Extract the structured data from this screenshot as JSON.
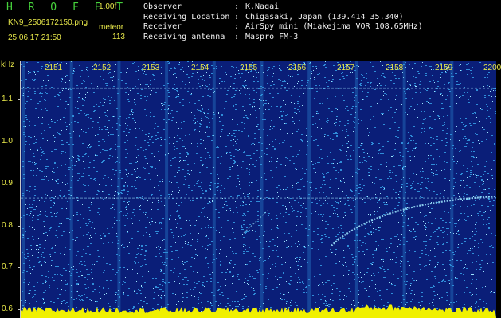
{
  "header": {
    "title": "H R O F F T",
    "version": "1.00f",
    "filename": "KN9_2506172150.png",
    "meteor_label": "meteor",
    "datetime": "25.06.17 21:50",
    "count": "113",
    "info": [
      {
        "key": "Observer",
        "value": "K.Nagai"
      },
      {
        "key": "Receiving Location",
        "value": "Chigasaki, Japan (139.414 35.340)"
      },
      {
        "key": "Receiver",
        "value": "AirSpy mini (Miakejima VOR 108.65MHz)"
      },
      {
        "key": "Receiving antenna",
        "value": "Maspro FM-3"
      }
    ],
    "separator": ":"
  },
  "colors": {
    "background": "#000000",
    "label": "#e8e84a",
    "title": "#46d23c",
    "text": "#f2f2f2",
    "spectrogram_base": "#0a1e78",
    "noise": "#2f8cd8",
    "signal": "#9ee6ff",
    "baseline": "#f0f000"
  },
  "spectrogram": {
    "y_unit": "kHz",
    "y_ticks": [
      "1.1",
      "1.0",
      "0.9",
      "0.8",
      "0.7",
      "0.6"
    ],
    "y_range": [
      0.58,
      1.19
    ],
    "x_ticks": [
      "2151",
      "2152",
      "2153",
      "2154",
      "2155",
      "2156",
      "2157",
      "2158",
      "2159",
      "2200"
    ],
    "carrier_khz": 0.865,
    "harmonic_khz": 1.125
  }
}
